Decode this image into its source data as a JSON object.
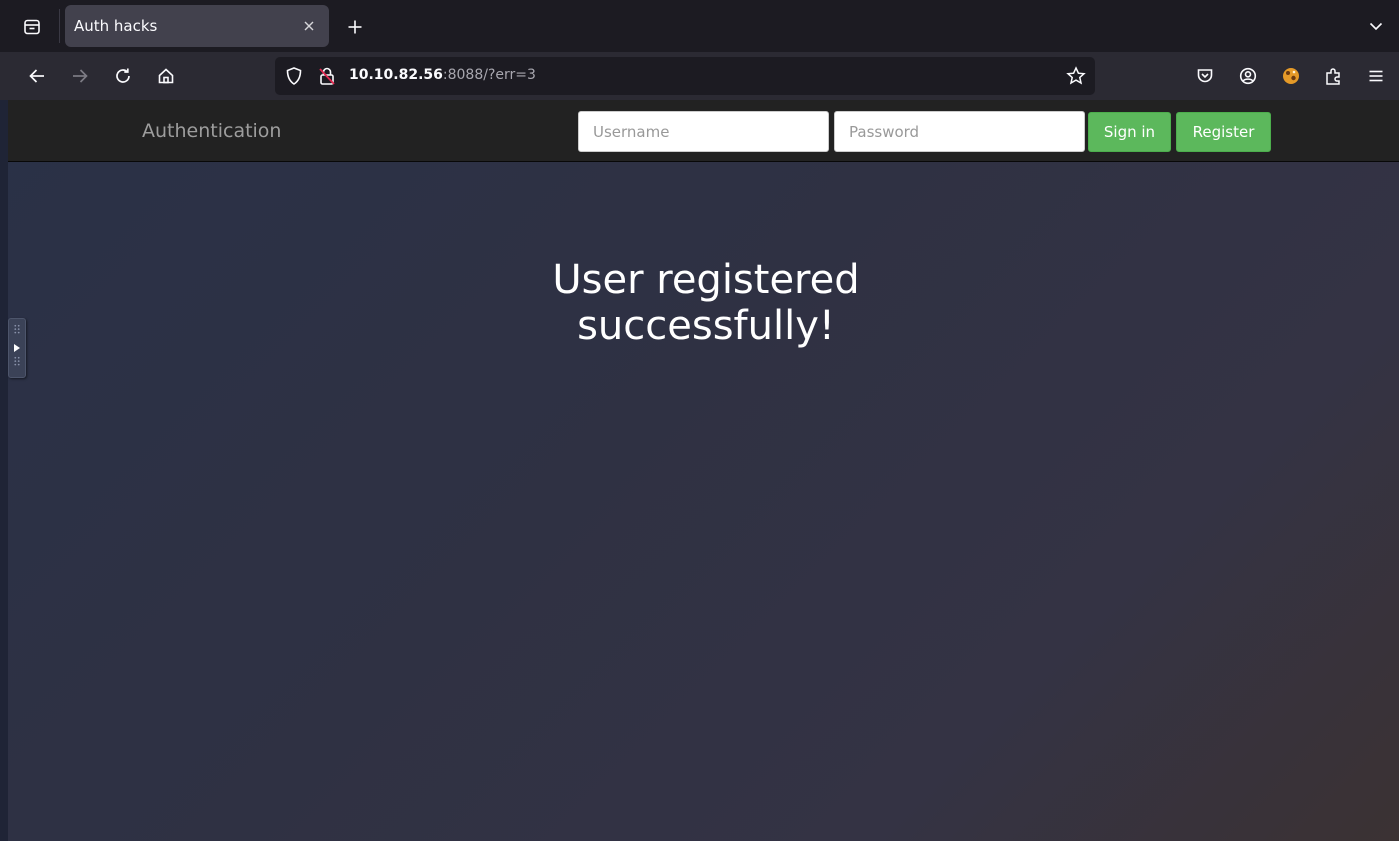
{
  "browser": {
    "tab": {
      "title": "Auth hacks"
    },
    "url": {
      "host": "10.10.82.56",
      "rest": ":8088/?err=3"
    }
  },
  "site": {
    "brand": "Authentication",
    "username_placeholder": "Username",
    "password_placeholder": "Password",
    "signin_label": "Sign in",
    "register_label": "Register",
    "message_line1": "User registered",
    "message_line2": "successfully!"
  },
  "colors": {
    "button_green": "#5cb85c",
    "navbar": "#222222"
  }
}
